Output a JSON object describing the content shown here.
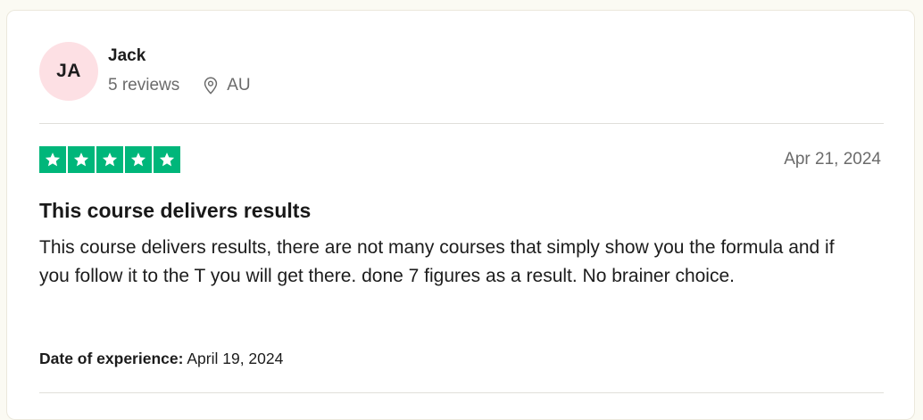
{
  "reviewer": {
    "initials": "JA",
    "name": "Jack",
    "review_count": "5 reviews",
    "location": "AU",
    "location_icon": "map-pin-icon",
    "avatar_color": "#fde0e4"
  },
  "review": {
    "rating": 5,
    "max_rating": 5,
    "star_color": "#00b67a",
    "date": "Apr 21, 2024",
    "title": "This course delivers results",
    "body": "This course delivers results, there are not many courses that simply show you the formula and if you follow it to the T you will get there. done 7 figures as a result. No brainer choice.",
    "experience_label": "Date of experience:",
    "experience_date": "April 19, 2024"
  }
}
